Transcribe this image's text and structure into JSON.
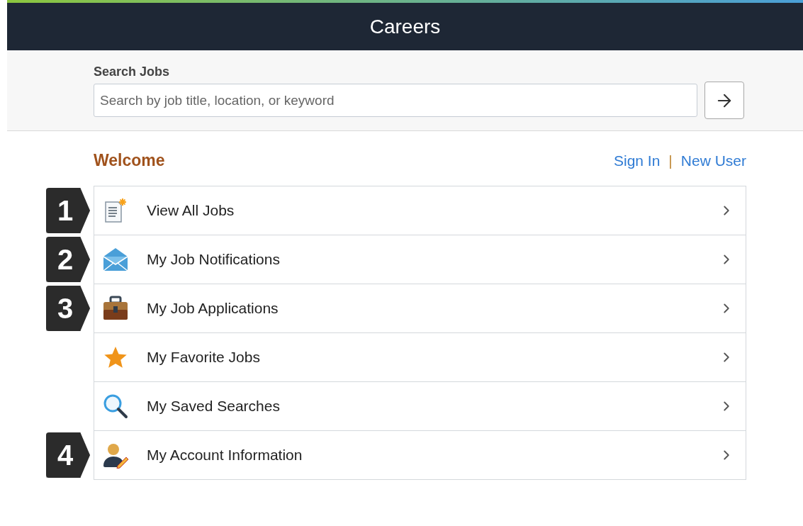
{
  "header": {
    "title": "Careers"
  },
  "search": {
    "label": "Search Jobs",
    "placeholder": "Search by job title, location, or keyword"
  },
  "welcome": {
    "title": "Welcome",
    "links": [
      "Sign In",
      "New User"
    ],
    "separator": "|"
  },
  "menu": [
    {
      "kind": "jobs",
      "label": "View All Jobs",
      "callout": "1"
    },
    {
      "kind": "notifications",
      "label": "My Job Notifications",
      "callout": "2"
    },
    {
      "kind": "applications",
      "label": "My Job Applications",
      "callout": "3"
    },
    {
      "kind": "favorites",
      "label": "My Favorite Jobs"
    },
    {
      "kind": "searches",
      "label": "My Saved Searches"
    },
    {
      "kind": "account",
      "label": "My Account Information",
      "callout": "4"
    }
  ]
}
